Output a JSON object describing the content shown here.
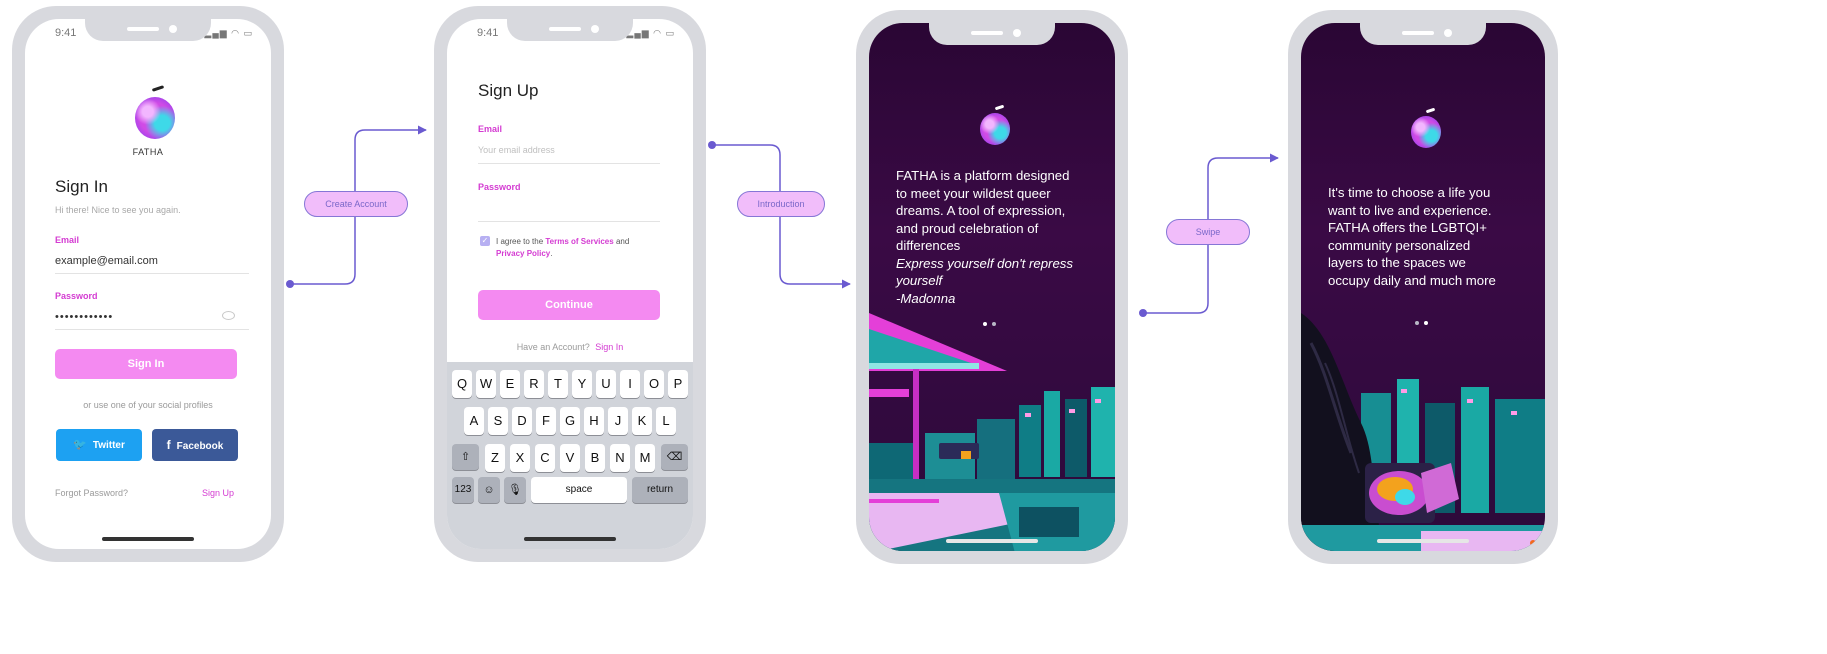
{
  "status_time": "9:41",
  "brand": {
    "name": "FATHA"
  },
  "sign_in": {
    "title": "Sign In",
    "subtitle": "Hi there! Nice to see you again.",
    "email_label": "Email",
    "email_value": "example@email.com",
    "password_label": "Password",
    "password_value": "••••••••••••",
    "button": "Sign In",
    "social_hint": "or use one of your social profiles",
    "twitter": "Twitter",
    "facebook": "Facebook",
    "forgot": "Forgot Password?",
    "sign_up_link": "Sign Up"
  },
  "sign_up": {
    "title": "Sign Up",
    "email_label": "Email",
    "email_placeholder": "Your email address",
    "password_label": "Password",
    "terms_prefix": "I agree to the ",
    "terms_link": "Terms of Services",
    "terms_and": " and",
    "privacy_link": "Privacy Policy",
    "privacy_suffix": ".",
    "button": "Continue",
    "have_account": "Have an Account?",
    "sign_in_link": "Sign In"
  },
  "keyboard": {
    "row1": [
      "Q",
      "W",
      "E",
      "R",
      "T",
      "Y",
      "U",
      "I",
      "O",
      "P"
    ],
    "row2": [
      "A",
      "S",
      "D",
      "F",
      "G",
      "H",
      "J",
      "K",
      "L"
    ],
    "row3": [
      "Z",
      "X",
      "C",
      "V",
      "B",
      "N",
      "M"
    ],
    "numbers": "123",
    "space": "space",
    "return": "return"
  },
  "intro1": {
    "line1": "FATHA is a platform designed",
    "line2": "to meet your wildest queer",
    "line3": "dreams. A tool of expression,",
    "line4": "and proud celebration of",
    "line5": "differences",
    "line6": "Express yourself don't repress",
    "line7": "yourself",
    "line8": "-Madonna"
  },
  "intro2": {
    "line1": "It's time to choose a life you",
    "line2": "want to live and experience.",
    "line3": "FATHA offers the LGBTQI+",
    "line4": "community personalized",
    "line5": "layers to the spaces we",
    "line6": "occupy daily and much more"
  },
  "flow": {
    "create_account": "Create Account",
    "introduction": "Introduction",
    "swipe": "Swipe"
  },
  "colors": {
    "accent_pink": "#f48af1",
    "label_magenta": "#d43cd2",
    "twitter_blue": "#1da1f2",
    "facebook_navy": "#3b5998",
    "intro_purple": "#3a0a45",
    "flow_line": "#6a5ad0"
  }
}
